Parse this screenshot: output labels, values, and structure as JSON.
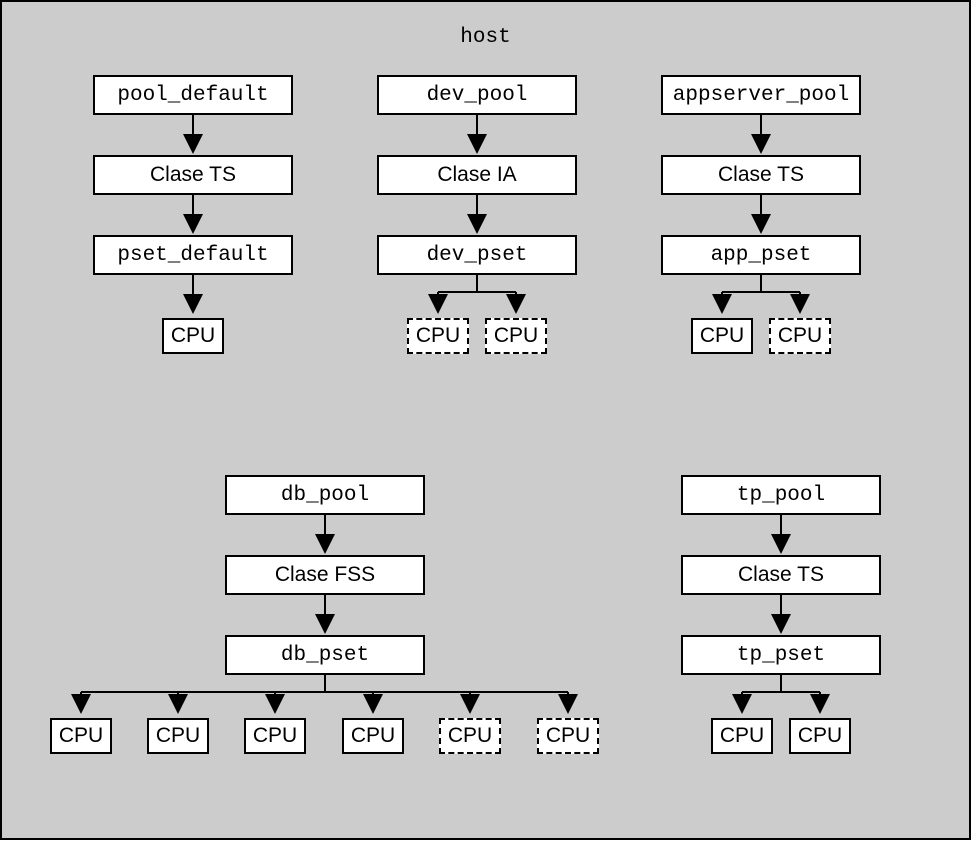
{
  "host_label": "host",
  "pools": [
    {
      "name": "pool_default",
      "class": "Clase TS",
      "pset": "pset_default"
    },
    {
      "name": "dev_pool",
      "class": "Clase IA",
      "pset": "dev_pset"
    },
    {
      "name": "appserver_pool",
      "class": "Clase TS",
      "pset": "app_pset"
    },
    {
      "name": "db_pool",
      "class": "Clase FSS",
      "pset": "db_pset"
    },
    {
      "name": "tp_pool",
      "class": "Clase TS",
      "pset": "tp_pset"
    }
  ],
  "cpu_label": "CPU"
}
